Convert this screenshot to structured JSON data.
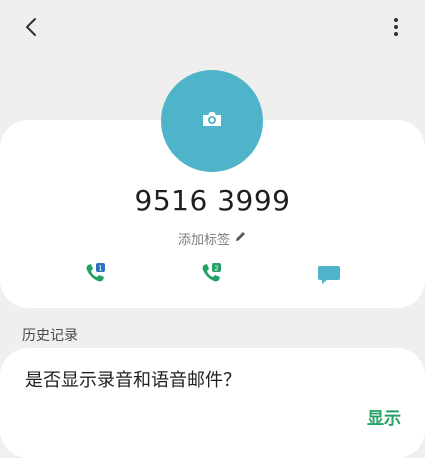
{
  "contact": {
    "number": "9516 3999",
    "add_tag_label": "添加标签"
  },
  "actions": [
    {
      "name": "sim1-call",
      "badge": "1"
    },
    {
      "name": "sim2-call",
      "badge": "2"
    },
    {
      "name": "message"
    }
  ],
  "history": {
    "section_label": "历史记录",
    "question": "是否显示录音和语音邮件？",
    "show_label": "显示"
  },
  "colors": {
    "accent_green": "#25a165",
    "avatar_bg": "#4fb4ca",
    "message_icon": "#4fb4ca"
  },
  "icons": [
    "back-arrow-icon",
    "more-options-icon",
    "camera-icon",
    "pencil-icon",
    "phone-sim1-icon",
    "phone-sim2-icon",
    "chat-bubble-icon"
  ]
}
